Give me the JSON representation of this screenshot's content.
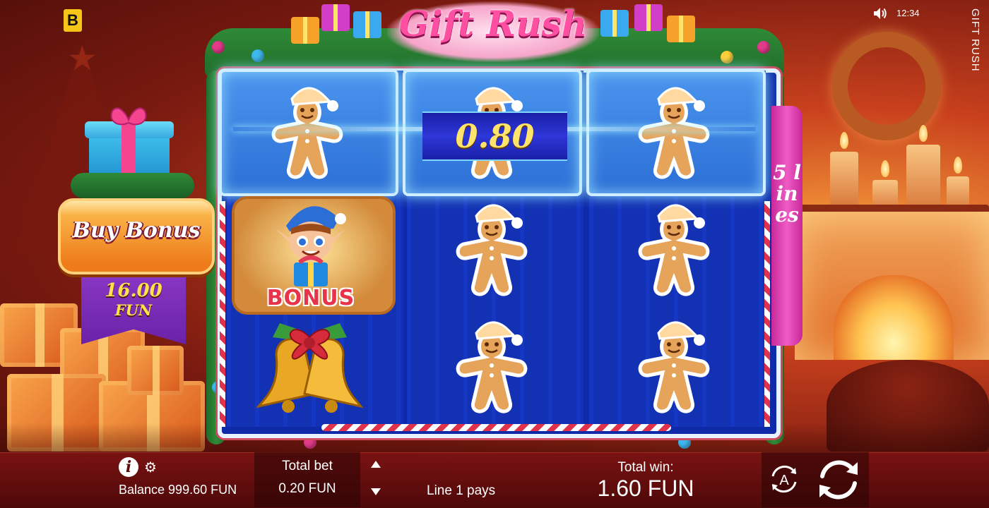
{
  "app": {
    "brand_letter": "B",
    "clock": "12:34",
    "vertical_title": "GIFT RUSH",
    "logo": "Gift Rush"
  },
  "buy_bonus": {
    "label": "Buy Bonus",
    "price": "16.00",
    "currency": "FUN"
  },
  "reels": {
    "win_amount": "0.80",
    "lines_label": "5 lines",
    "bonus_symbol_text": "BONUS",
    "grid": [
      [
        "gingerbread-man",
        "gingerbread-man",
        "gingerbread-man"
      ],
      [
        "elf-bonus",
        "gingerbread-man",
        "gingerbread-man"
      ],
      [
        "bell",
        "gingerbread-man",
        "gingerbread-man"
      ]
    ]
  },
  "footer": {
    "balance": "Balance 999.60 FUN",
    "total_bet_label": "Total bet",
    "total_bet_value": "0.20 FUN",
    "line_pays": "Line 1 pays",
    "total_win_label": "Total win:",
    "total_win_value": "1.60 FUN",
    "auto_label": "A"
  },
  "colors": {
    "accent_pink": "#ff4fa3",
    "win_gold": "#ffe36a",
    "reel_blue": "#1636c4",
    "bottom_bar": "#6a1010"
  },
  "icons": {
    "info": "info-icon",
    "settings": "gear-icon",
    "sound": "speaker-icon",
    "bet_up": "triangle-up-icon",
    "bet_down": "triangle-down-icon",
    "autoplay": "autoplay-icon",
    "spin": "spin-icon"
  }
}
